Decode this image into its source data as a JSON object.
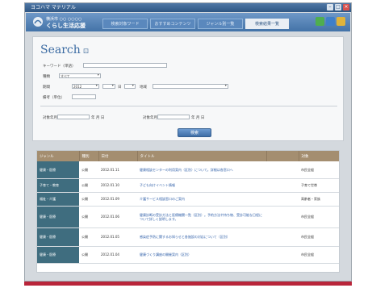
{
  "window": {
    "title": "ヨコハマ マテリアル"
  },
  "header": {
    "logo_line1": "横浜市 ○○ ○○○○",
    "logo_line2": "くらし生活応援",
    "tabs": [
      {
        "label": "検索対象ワード"
      },
      {
        "label": "おすすめコンテンツ"
      },
      {
        "label": "ジャンル別一覧"
      },
      {
        "label": "検索結果一覧"
      }
    ],
    "icon_colors": [
      "#4fae4f",
      "#3f7fc9",
      "#e0b33a"
    ]
  },
  "search": {
    "title": "Search",
    "title_glyph": "⊡",
    "keyword_label": "キーワード（単語）",
    "keyword_value": "",
    "category_label": "種類",
    "category_value": "すべて",
    "date_label": "期間",
    "date_from": "2012",
    "date_to": "",
    "date_unit": "日",
    "area_label": "地域",
    "area_value": "",
    "note_label": "備考（単位）",
    "note_value": "",
    "range_label1": "対象年月",
    "range_mid": "年 月 日",
    "range_label2": "対象年月",
    "range_end": "年 月 日",
    "submit_label": "検索"
  },
  "results": {
    "columns": [
      "ジャンル",
      "種別",
      "日付",
      "タイトル",
      "",
      "対象"
    ],
    "rows": [
      {
        "cat": "健康・医療",
        "type": "公開",
        "date": "2012.01.11",
        "title": "健康相談センターの利用案内（区別）について。詳細は各窓口へ",
        "col5": "",
        "target": "市民全般"
      },
      {
        "cat": "子育て・教育",
        "type": "公開",
        "date": "2012.01.10",
        "title": "子ども向けイベント情報",
        "col5": "",
        "target": "子育て世帯"
      },
      {
        "cat": "福祉・介護",
        "type": "公開",
        "date": "2012.01.09",
        "title": "介護サービス相談窓口のご案内",
        "col5": "",
        "target": "高齢者・家族"
      },
      {
        "cat": "健康・医療",
        "type": "公開",
        "date": "2012.01.06",
        "title": "健康診断の受診方法と医療機関一覧（区別）。予約方法や持ち物、受診可能な日程について詳しく説明します。",
        "col5": "",
        "target": "市民全般"
      },
      {
        "cat": "健康・医療",
        "type": "公開",
        "date": "2012.01.05",
        "title": "感染症予防に関するお知らせと各施設の対応について（区別）",
        "col5": "",
        "target": "市民全般"
      },
      {
        "cat": "健康・医療",
        "type": "公開",
        "date": "2012.01.04",
        "title": "健康づくり講座の開催案内（区別）",
        "col5": "",
        "target": "市民全般"
      }
    ]
  }
}
